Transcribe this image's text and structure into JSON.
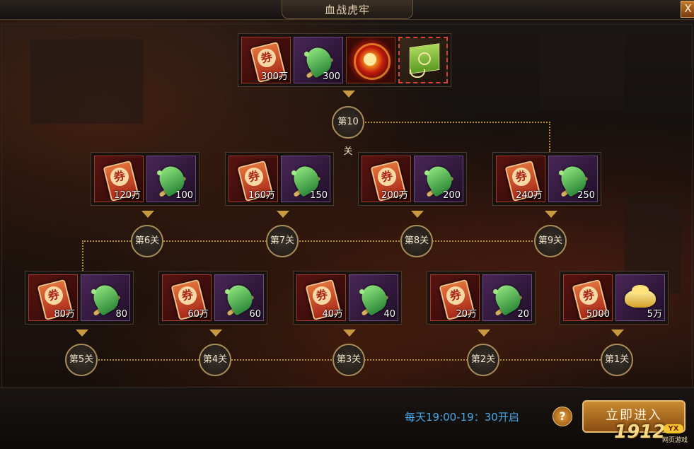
{
  "window": {
    "title": "血战虎牢",
    "close_glyph": "X"
  },
  "ticket_glyph": "券",
  "stages": [
    {
      "label": "第10关",
      "rewards": [
        {
          "type": "ticket",
          "icon": "coupon-ticket-icon",
          "qty": "300万"
        },
        {
          "type": "fish",
          "icon": "jade-fish-icon",
          "qty": "300"
        },
        {
          "type": "orb",
          "icon": "fire-orb-icon",
          "qty": ""
        },
        {
          "type": "box",
          "icon": "gift-box-icon",
          "qty": ""
        }
      ]
    },
    {
      "label": "第6关",
      "rewards": [
        {
          "type": "ticket",
          "icon": "coupon-ticket-icon",
          "qty": "120万"
        },
        {
          "type": "fish",
          "icon": "jade-fish-icon",
          "qty": "100"
        }
      ]
    },
    {
      "label": "第7关",
      "rewards": [
        {
          "type": "ticket",
          "icon": "coupon-ticket-icon",
          "qty": "160万"
        },
        {
          "type": "fish",
          "icon": "jade-fish-icon",
          "qty": "150"
        }
      ]
    },
    {
      "label": "第8关",
      "rewards": [
        {
          "type": "ticket",
          "icon": "coupon-ticket-icon",
          "qty": "200万"
        },
        {
          "type": "fish",
          "icon": "jade-fish-icon",
          "qty": "200"
        }
      ]
    },
    {
      "label": "第9关",
      "rewards": [
        {
          "type": "ticket",
          "icon": "coupon-ticket-icon",
          "qty": "240万"
        },
        {
          "type": "fish",
          "icon": "jade-fish-icon",
          "qty": "250"
        }
      ]
    },
    {
      "label": "第5关",
      "rewards": [
        {
          "type": "ticket",
          "icon": "coupon-ticket-icon",
          "qty": "80万"
        },
        {
          "type": "fish",
          "icon": "jade-fish-icon",
          "qty": "80"
        }
      ]
    },
    {
      "label": "第4关",
      "rewards": [
        {
          "type": "ticket",
          "icon": "coupon-ticket-icon",
          "qty": "60万"
        },
        {
          "type": "fish",
          "icon": "jade-fish-icon",
          "qty": "60"
        }
      ]
    },
    {
      "label": "第3关",
      "rewards": [
        {
          "type": "ticket",
          "icon": "coupon-ticket-icon",
          "qty": "40万"
        },
        {
          "type": "fish",
          "icon": "jade-fish-icon",
          "qty": "40"
        }
      ]
    },
    {
      "label": "第2关",
      "rewards": [
        {
          "type": "ticket",
          "icon": "coupon-ticket-icon",
          "qty": "20万"
        },
        {
          "type": "fish",
          "icon": "jade-fish-icon",
          "qty": "20"
        }
      ]
    },
    {
      "label": "第1关",
      "rewards": [
        {
          "type": "ticket",
          "icon": "coupon-ticket-icon",
          "qty": "5000"
        },
        {
          "type": "gold",
          "icon": "gold-ingot-icon",
          "qty": "5万"
        }
      ]
    }
  ],
  "footer": {
    "schedule": "每天19:00-19：30开启",
    "help_glyph": "?",
    "enter_label": "立即进入"
  },
  "watermark": {
    "number": "1912",
    "badge": "YX",
    "sub": "网页游戏"
  }
}
